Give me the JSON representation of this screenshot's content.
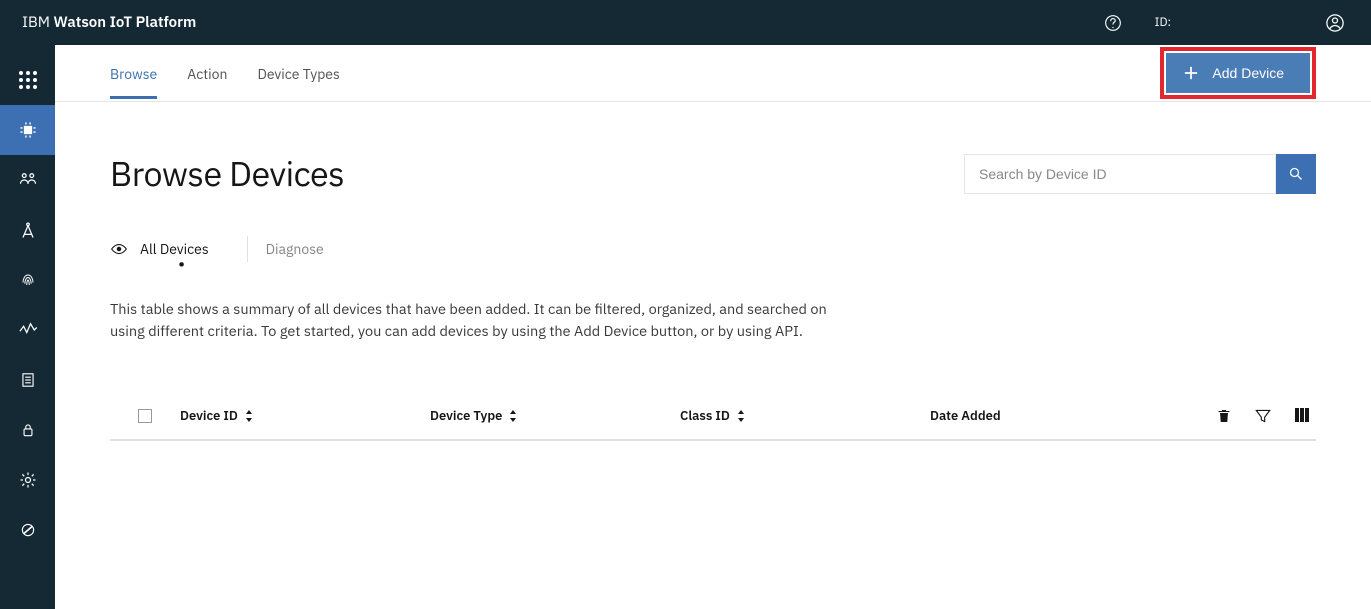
{
  "header": {
    "brand_prefix": "IBM ",
    "brand_strong": "Watson IoT Platform",
    "id_label": "ID:"
  },
  "tabs": {
    "browse": "Browse",
    "action": "Action",
    "device_types": "Device Types",
    "add_device": "Add Device"
  },
  "page": {
    "title": "Browse Devices",
    "search_placeholder": "Search by Device ID"
  },
  "subtabs": {
    "all_devices": "All Devices",
    "diagnose": "Diagnose"
  },
  "description": "This table shows a summary of all devices that have been added. It can be filtered, organized, and searched on using different criteria. To get started, you can add devices by using the Add Device button, or by using API.",
  "table_headers": {
    "device_id": "Device ID",
    "device_type": "Device Type",
    "class_id": "Class ID",
    "date_added": "Date Added"
  }
}
